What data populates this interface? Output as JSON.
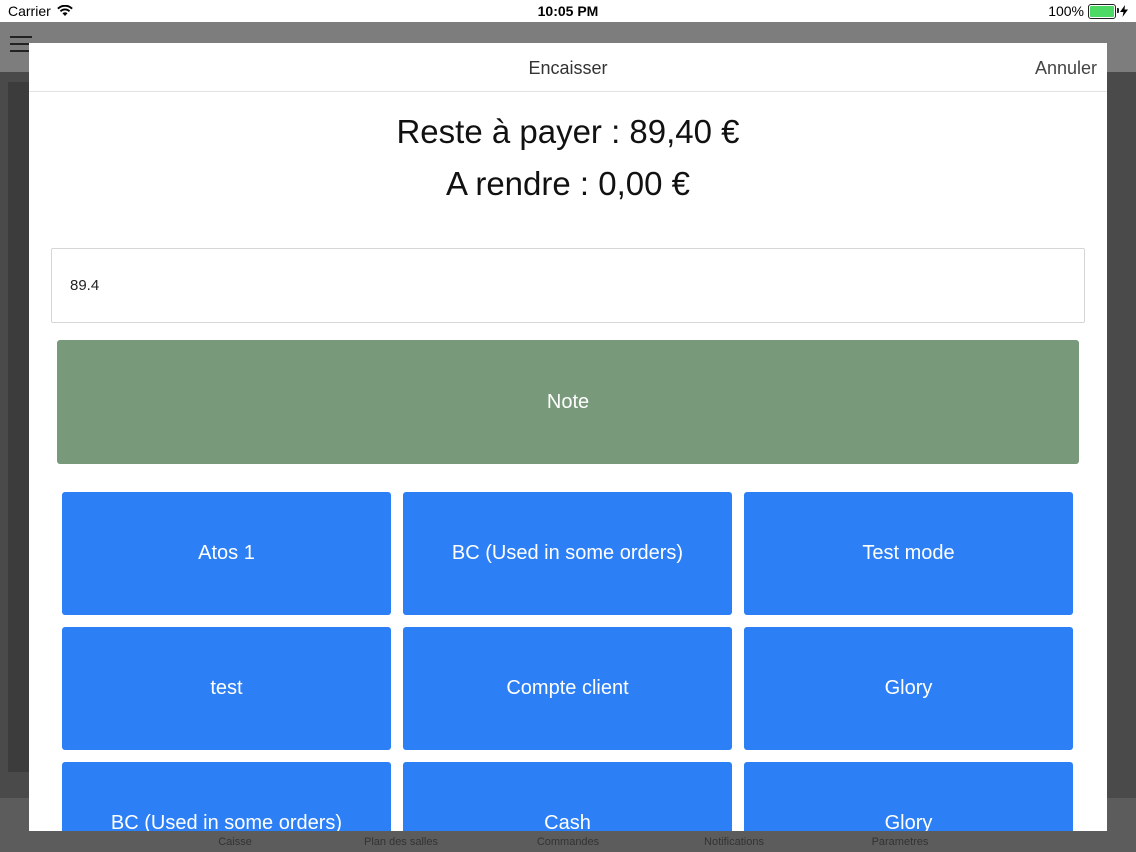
{
  "status_bar": {
    "carrier": "Carrier",
    "time": "10:05 PM",
    "battery": "100%"
  },
  "background": {
    "tabs": [
      "Caisse",
      "Plan des salles",
      "Commandes",
      "Notifications",
      "Parametres"
    ]
  },
  "modal": {
    "title": "Encaisser",
    "cancel_label": "Annuler",
    "remaining": "Reste à payer : 89,40 €",
    "change": "A rendre : 0,00 €",
    "amount_value": "89.4",
    "note_label": "Note"
  },
  "payment_methods": [
    "Atos 1",
    "BC (Used in some orders)",
    "Test mode",
    "test",
    "Compte client",
    "Glory",
    "BC (Used in some orders)",
    "Cash",
    "Glory"
  ],
  "colors": {
    "note_button": "#789a7a",
    "payment_button": "#2d7ff5"
  }
}
